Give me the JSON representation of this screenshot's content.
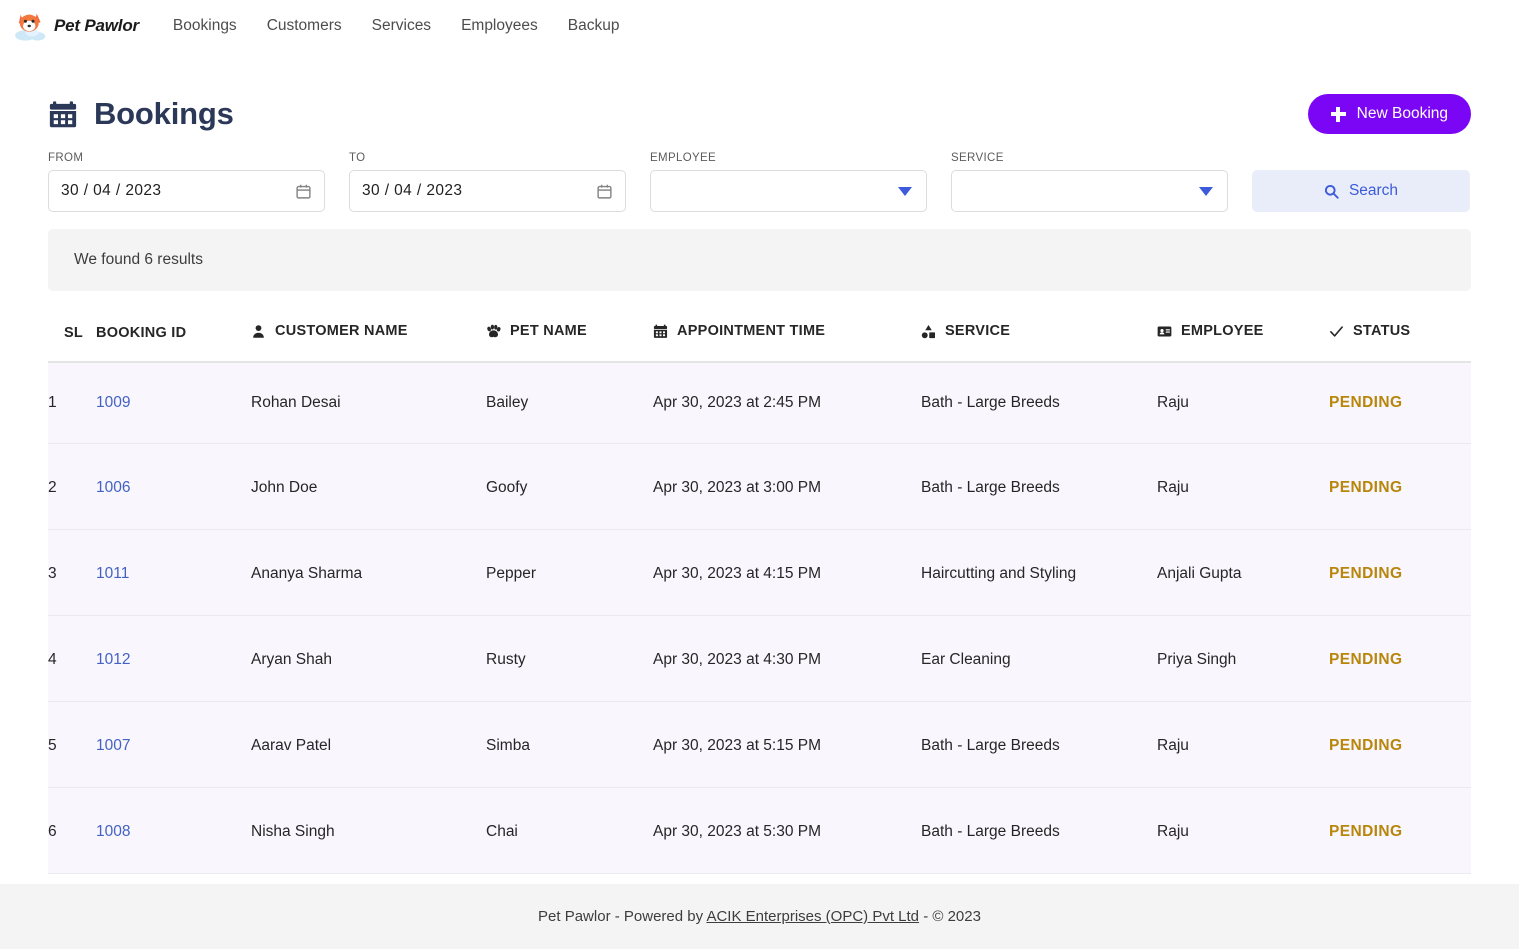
{
  "navbar": {
    "brand": {
      "text": "Pet Pawlor",
      "logo_icon": "fox-pet-logo-icon"
    },
    "links": [
      {
        "label": "Bookings"
      },
      {
        "label": "Customers"
      },
      {
        "label": "Services"
      },
      {
        "label": "Employees"
      },
      {
        "label": "Backup"
      }
    ]
  },
  "header": {
    "title": "Bookings",
    "title_icon": "calendar-icon",
    "new_booking_label": "New Booking",
    "new_booking_icon": "plus-icon",
    "accent_color": "#7b05f5"
  },
  "filters": {
    "from": {
      "label": "FROM",
      "value": "30 / 04 / 2023",
      "icon": "calendar-picker-icon"
    },
    "to": {
      "label": "TO",
      "value": "30 / 04 / 2023",
      "icon": "calendar-picker-icon"
    },
    "employee": {
      "label": "EMPLOYEE",
      "value": "",
      "icon": "chevron-down-icon"
    },
    "service": {
      "label": "SERVICE",
      "value": "",
      "icon": "chevron-down-icon"
    },
    "search": {
      "label": "Search",
      "icon": "search-icon",
      "bg": "#e9edfa",
      "fg": "#3b5bdb"
    }
  },
  "results_banner": {
    "text": "We found 6 results"
  },
  "table": {
    "columns": [
      {
        "key": "sl",
        "label": "SL",
        "icon": null
      },
      {
        "key": "booking_id",
        "label": "BOOKING ID",
        "icon": null
      },
      {
        "key": "customer_name",
        "label": "CUSTOMER NAME",
        "icon": "person-icon"
      },
      {
        "key": "pet_name",
        "label": "PET NAME",
        "icon": "paw-icon"
      },
      {
        "key": "appointment_time",
        "label": "APPOINTMENT TIME",
        "icon": "calendar-icon"
      },
      {
        "key": "service",
        "label": "SERVICE",
        "icon": "shapes-icon"
      },
      {
        "key": "employee",
        "label": "EMPLOYEE",
        "icon": "id-badge-icon"
      },
      {
        "key": "status",
        "label": "STATUS",
        "icon": "check-icon"
      }
    ],
    "rows": [
      {
        "sl": "1",
        "booking_id": "1009",
        "customer_name": "Rohan Desai",
        "pet_name": "Bailey",
        "appointment_time": "Apr 30, 2023 at 2:45 PM",
        "service": "Bath - Large Breeds",
        "employee": "Raju",
        "status": "PENDING"
      },
      {
        "sl": "2",
        "booking_id": "1006",
        "customer_name": "John Doe",
        "pet_name": "Goofy",
        "appointment_time": "Apr 30, 2023 at 3:00 PM",
        "service": "Bath - Large Breeds",
        "employee": "Raju",
        "status": "PENDING"
      },
      {
        "sl": "3",
        "booking_id": "1011",
        "customer_name": "Ananya Sharma",
        "pet_name": "Pepper",
        "appointment_time": "Apr 30, 2023 at 4:15 PM",
        "service": "Haircutting and Styling",
        "employee": "Anjali Gupta",
        "status": "PENDING"
      },
      {
        "sl": "4",
        "booking_id": "1012",
        "customer_name": "Aryan Shah",
        "pet_name": "Rusty",
        "appointment_time": "Apr 30, 2023 at 4:30 PM",
        "service": "Ear Cleaning",
        "employee": "Priya Singh",
        "status": "PENDING"
      },
      {
        "sl": "5",
        "booking_id": "1007",
        "customer_name": "Aarav Patel",
        "pet_name": "Simba",
        "appointment_time": "Apr 30, 2023 at 5:15 PM",
        "service": "Bath - Large Breeds",
        "employee": "Raju",
        "status": "PENDING"
      },
      {
        "sl": "6",
        "booking_id": "1008",
        "customer_name": "Nisha Singh",
        "pet_name": "Chai",
        "appointment_time": "Apr 30, 2023 at 5:30 PM",
        "service": "Bath - Large Breeds",
        "employee": "Raju",
        "status": "PENDING"
      }
    ]
  },
  "footer": {
    "prefix": "Pet Pawlor - Powered by ",
    "link": "ACIK Enterprises (OPC) Pvt Ltd",
    "suffix": " - © 2023"
  }
}
